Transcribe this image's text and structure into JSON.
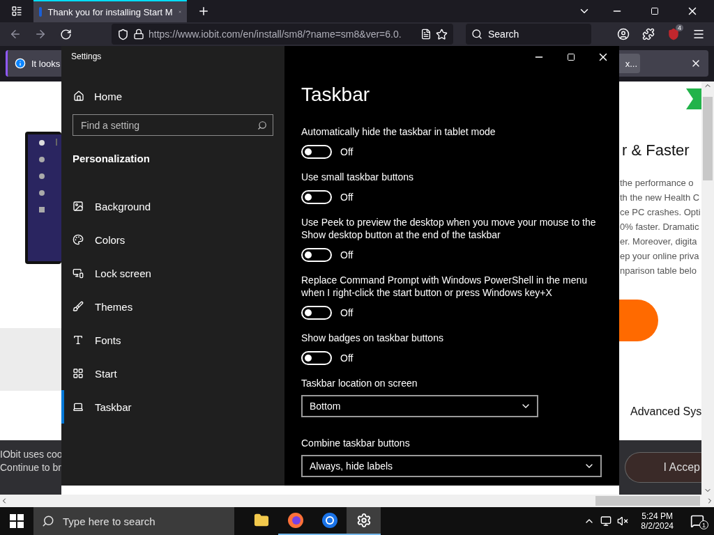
{
  "browser": {
    "tab_title": "Thank you for installing Start M",
    "url": "https://www.iobit.com/en/install/sm8/?name=sm8&ver=6.0.",
    "search_placeholder": "Search",
    "extension_badge": "4",
    "notification": {
      "text": "It looks",
      "button": "x..."
    }
  },
  "web_page": {
    "heading": "r & Faster",
    "paragraph_lines": [
      "the performance o",
      "th the new Health C",
      "ce PC crashes. Opti",
      "0% faster. Dramatic",
      "er. Moreover, digita",
      "ep your online priva",
      "nparison table belo"
    ],
    "product_title": "Advanced Sys",
    "cookie_lines": [
      "IObit uses coo",
      "Continue to br"
    ],
    "accept_button": "I Accep"
  },
  "settings": {
    "title": "Settings",
    "home": "Home",
    "search_placeholder": "Find a setting",
    "section": "Personalization",
    "nav_items": [
      {
        "label": "Background",
        "selected": false
      },
      {
        "label": "Colors",
        "selected": false
      },
      {
        "label": "Lock screen",
        "selected": false
      },
      {
        "label": "Themes",
        "selected": false
      },
      {
        "label": "Fonts",
        "selected": false
      },
      {
        "label": "Start",
        "selected": false
      },
      {
        "label": "Taskbar",
        "selected": true
      }
    ],
    "page_title": "Taskbar",
    "toggles": [
      {
        "label": "Automatically hide the taskbar in tablet mode",
        "on": false,
        "state_text": "Off"
      },
      {
        "label": "Use small taskbar buttons",
        "on": false,
        "state_text": "Off"
      },
      {
        "label": "Use Peek to preview the desktop when you move your mouse to the Show desktop button at the end of the taskbar",
        "on": false,
        "state_text": "Off"
      },
      {
        "label": "Replace Command Prompt with Windows PowerShell in the menu when I right-click the start button or press Windows key+X",
        "on": false,
        "state_text": "Off"
      },
      {
        "label": "Show badges on taskbar buttons",
        "on": false,
        "state_text": "Off"
      }
    ],
    "dropdowns": [
      {
        "label": "Taskbar location on screen",
        "value": "Bottom"
      },
      {
        "label": "Combine taskbar buttons",
        "value": "Always, hide labels"
      }
    ]
  },
  "taskbar": {
    "search_placeholder": "Type here to search",
    "apps": [
      {
        "kind": "files",
        "selected": false,
        "running": false
      },
      {
        "kind": "firefox",
        "selected": false,
        "running": true
      },
      {
        "kind": "chrome",
        "selected": false,
        "running": true
      },
      {
        "kind": "settings",
        "selected": true,
        "running": true
      }
    ],
    "time": "5:24 PM",
    "date": "8/2/2024",
    "notification_count": "1"
  }
}
